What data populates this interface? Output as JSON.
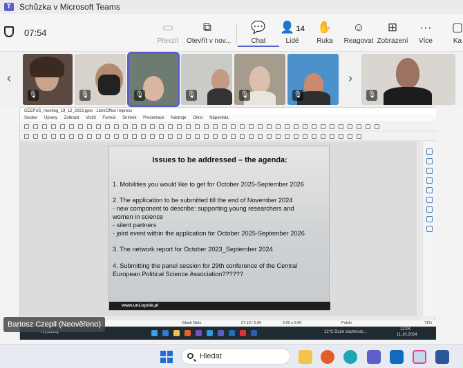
{
  "window": {
    "title": "Schůzka v Microsoft Teams"
  },
  "toolbar": {
    "timer": "07:54",
    "preview_label": "Převzít",
    "open_label": "Otevřít v nov...",
    "chat_label": "Chat",
    "people_label": "Lidé",
    "people_count": "14",
    "hand_label": "Ruka",
    "react_label": "Reagovat",
    "view_label": "Zobrazení",
    "more_label": "Více",
    "cut_label": "Ka"
  },
  "participants": {
    "count_tiles": 7
  },
  "impress": {
    "window_title": "CEEPUS_meeting_19_12_2023.pptx - LibreOffice Impress",
    "menu": [
      "Soubor",
      "Úpravy",
      "Zobrazit",
      "Vložit",
      "Formát",
      "Snímek",
      "Prezentace",
      "Nástroje",
      "Okno",
      "Nápověda"
    ],
    "slide": {
      "title": "Issues to be addressed – the agenda:",
      "lines": [
        "1. Mobilities you would like to get for October 2025-September 2026",
        "2. The application to be submitted till the end of November 2024",
        "- new component to describe: supporting young researchers and",
        "women in science",
        "- silent partners",
        "- joint event within the application for October 2025-September 2026",
        "3. The network report for October 2023_September 2024",
        "4. Submitting the  panel session for 29th conference of the Central",
        "European Political Science Association??????"
      ],
      "footer": "www.uni.opole.pl"
    },
    "status": {
      "layout": "Blank Slide",
      "position": "27.10 / 2.96",
      "size": "0.00 x 0.00",
      "language": "Polski",
      "zoom": "71%"
    }
  },
  "shared_taskbar": {
    "search": "Wyszukaj",
    "weather": "12°C  Duże zachmurz...",
    "time": "12:04",
    "date": "11.10.2024"
  },
  "speaker_tag": "Bartosz Czepil (Neověřeno)",
  "taskbar": {
    "search_placeholder": "Hledat"
  },
  "colors": {
    "accent": "#5b5fc7",
    "slide_footer": "#1e1e1e"
  }
}
